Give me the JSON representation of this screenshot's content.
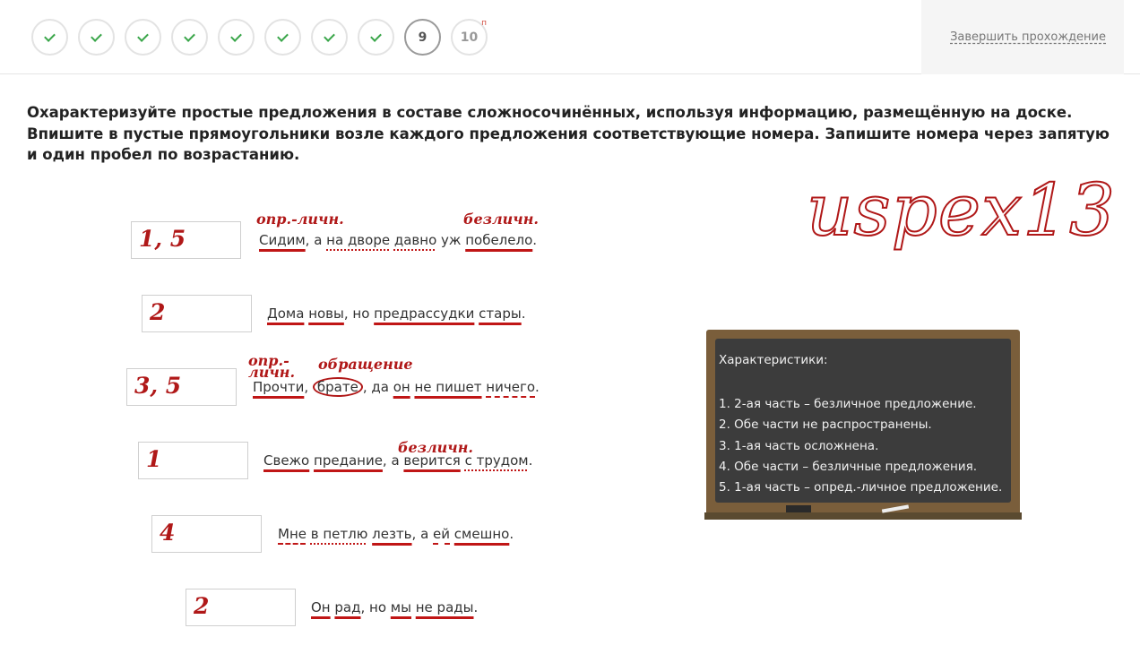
{
  "progress": {
    "steps": [
      {
        "label": "",
        "state": "done"
      },
      {
        "label": "",
        "state": "done"
      },
      {
        "label": "",
        "state": "done"
      },
      {
        "label": "",
        "state": "done"
      },
      {
        "label": "",
        "state": "done"
      },
      {
        "label": "",
        "state": "done"
      },
      {
        "label": "",
        "state": "done"
      },
      {
        "label": "",
        "state": "done"
      },
      {
        "label": "9",
        "state": "current"
      },
      {
        "label": "10",
        "state": "locked",
        "flag": "п"
      }
    ],
    "finish_label": "Завершить прохождение"
  },
  "question": {
    "text": "Охарактеризуйте простые предложения в составе сложносочинённых, используя информацию, размещённую на доске. Впишите в пустые прямоугольники возле каждого предложения соответствующие номера. Запишите номера через запятую и один пробел по возрастанию."
  },
  "answers": [
    "1, 5",
    "2",
    "3, 5",
    "1",
    "4",
    "2"
  ],
  "annotations": {
    "s1_a": "опр.-личн.",
    "s1_b": "безличн.",
    "s3_a": "опр.-",
    "s3_b": "личн.",
    "s3_c": "обращение",
    "s4_a": "безличн."
  },
  "sentences": {
    "s1": {
      "w1": "Сидим",
      "t1": ", а ",
      "w2": "на дворе",
      "t2": " ",
      "w3": "давно",
      "t3": " ",
      "w4": "уж",
      "t4": " ",
      "w5": "побелело",
      "end": "."
    },
    "s2": {
      "w1": "Дома",
      "t1": " ",
      "w2": "новы",
      "t2": ", но ",
      "w3": "предрассудки",
      "t3": " ",
      "w4": "стары",
      "end": "."
    },
    "s3": {
      "w1": "Прочти",
      "t1": ", ",
      "w2": "брате",
      "t2": ", да ",
      "w3": "он",
      "t3": " ",
      "w4": "не пишет",
      "t4": " ",
      "w5": "ничего",
      "end": "."
    },
    "s4": {
      "w1": "Свежо",
      "t1": " ",
      "w2": "предание",
      "t2": ", а ",
      "w3": "верится",
      "t3": " ",
      "w4": "с трудом",
      "end": "."
    },
    "s5": {
      "w1": "Мне",
      "t1": " ",
      "w2": "в петлю",
      "t2": " ",
      "w3": "лезть",
      "t3": ", а ",
      "w4": "ей",
      "t4": " ",
      "w5": "смешно",
      "end": "."
    },
    "s6": {
      "w1": "Он",
      "t1": " ",
      "w2": "рад",
      "t2": ", но ",
      "w3": "мы",
      "t3": " ",
      "w4": "не рады",
      "end": "."
    }
  },
  "watermark": "uspex13",
  "board": {
    "title": "Характеристики:",
    "items": [
      "1. 2-ая часть – безличное предложение.",
      "2. Обе части не распространены.",
      "3. 1-ая часть осложнена.",
      "4. Обе части – безличные предложения.",
      "5. 1-ая часть – опред.-личное предложение."
    ]
  },
  "colors": {
    "check": "#3aa64a",
    "annotation": "#b01818",
    "board": "#3c3c3c",
    "board_frame": "#7a5e3b"
  }
}
